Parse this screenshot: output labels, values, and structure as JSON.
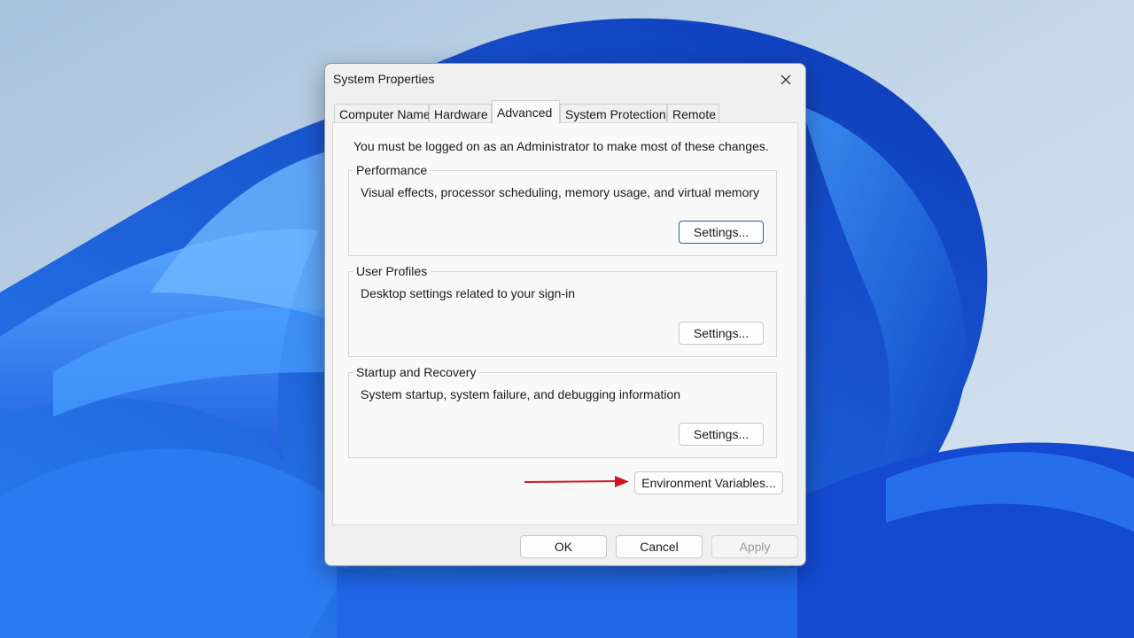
{
  "window": {
    "title": "System Properties"
  },
  "tabs": [
    {
      "label": "Computer Name",
      "active": false
    },
    {
      "label": "Hardware",
      "active": false
    },
    {
      "label": "Advanced",
      "active": true
    },
    {
      "label": "System Protection",
      "active": false
    },
    {
      "label": "Remote",
      "active": false
    }
  ],
  "advanced": {
    "admin_note": "You must be logged on as an Administrator to make most of these changes.",
    "groups": [
      {
        "label": "Performance",
        "description": "Visual effects, processor scheduling, memory usage, and virtual memory",
        "button": "Settings..."
      },
      {
        "label": "User Profiles",
        "description": "Desktop settings related to your sign-in",
        "button": "Settings..."
      },
      {
        "label": "Startup and Recovery",
        "description": "System startup, system failure, and debugging information",
        "button": "Settings..."
      }
    ],
    "env_button": "Environment Variables..."
  },
  "footer": {
    "ok": "OK",
    "cancel": "Cancel",
    "apply": "Apply"
  },
  "colors": {
    "accent": "#1a5fb4",
    "annotation_arrow": "#d4141c"
  },
  "icons": {
    "close": "close-icon",
    "annotation": "red-arrow-icon"
  }
}
